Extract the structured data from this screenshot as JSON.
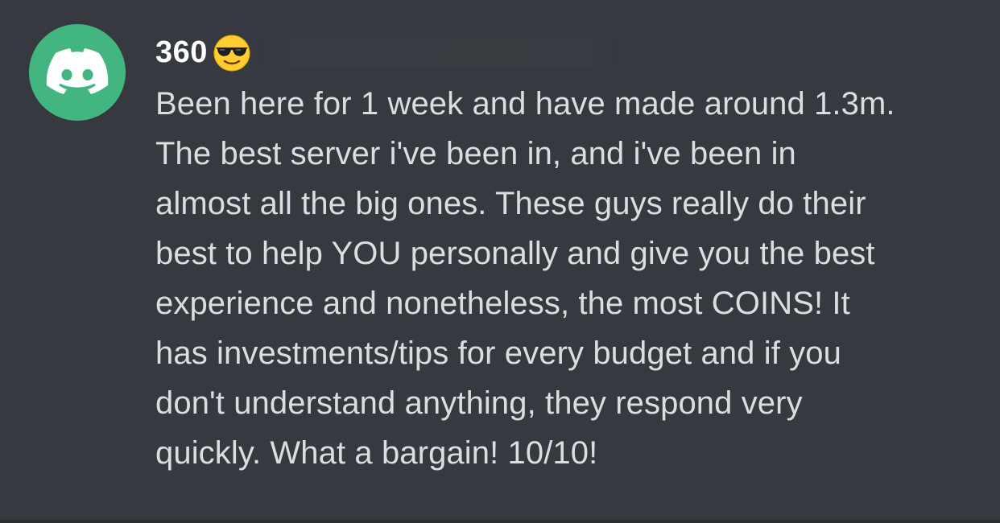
{
  "message": {
    "author": "360",
    "emoji": "smiling-face-with-sunglasses",
    "avatar_color": "#43b581",
    "lines": [
      "Been here for 1 week and have made around 1.3m.",
      "The best server i've been in, and i've been in",
      "almost all the big ones. These guys really do their",
      "best to help YOU personally and give you the best",
      "experience and nonetheless, the most COINS! It",
      "has investments/tips for every budget and if you",
      "don't understand anything, they respond very",
      "quickly. What a bargain! 10/10!"
    ]
  },
  "colors": {
    "background": "#36393f",
    "username": "#ffffff",
    "text": "#dcddde"
  }
}
